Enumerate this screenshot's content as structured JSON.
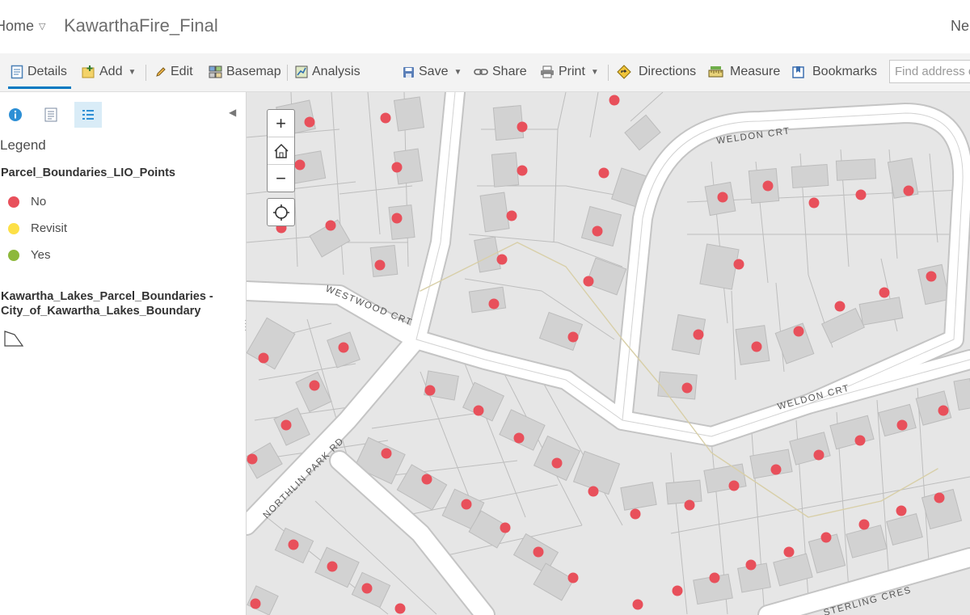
{
  "header": {
    "home_label": "Home",
    "map_title": "KawarthaFire_Final",
    "right_label": "Ne"
  },
  "toolbar": {
    "details": "Details",
    "add": "Add",
    "edit": "Edit",
    "basemap": "Basemap",
    "analysis": "Analysis",
    "save": "Save",
    "share": "Share",
    "print": "Print",
    "directions": "Directions",
    "measure": "Measure",
    "bookmarks": "Bookmarks",
    "search_placeholder": "Find address or place"
  },
  "panel": {
    "legend_title": "Legend",
    "layer1_title": "Parcel_Boundaries_LIO_Points",
    "legend_items": [
      {
        "label": "No",
        "color": "#e8505b"
      },
      {
        "label": "Revisit",
        "color": "#fde047"
      },
      {
        "label": "Yes",
        "color": "#8db83b"
      }
    ],
    "layer2_title_line1": "Kawartha_Lakes_Parcel_Boundaries -",
    "layer2_title_line2": "City_of_Kawartha_Lakes_Boundary"
  },
  "map": {
    "road_labels": [
      "WELDON CRT",
      "WESTWOOD CRT",
      "WELDON CRT",
      "NORTHLIN PARK RD",
      "STERLING CRES"
    ],
    "point_color": "#e8505b",
    "points": [
      [
        383,
        151
      ],
      [
        477,
        146
      ],
      [
        646,
        157
      ],
      [
        760,
        124
      ],
      [
        371,
        204
      ],
      [
        491,
        207
      ],
      [
        646,
        211
      ],
      [
        747,
        214
      ],
      [
        348,
        282
      ],
      [
        409,
        279
      ],
      [
        491,
        270
      ],
      [
        633,
        267
      ],
      [
        739,
        286
      ],
      [
        470,
        328
      ],
      [
        621,
        321
      ],
      [
        728,
        348
      ],
      [
        611,
        376
      ],
      [
        709,
        417
      ],
      [
        894,
        244
      ],
      [
        950,
        230
      ],
      [
        1007,
        251
      ],
      [
        1065,
        241
      ],
      [
        1124,
        236
      ],
      [
        914,
        327
      ],
      [
        1039,
        379
      ],
      [
        1094,
        362
      ],
      [
        1152,
        342
      ],
      [
        864,
        414
      ],
      [
        936,
        429
      ],
      [
        988,
        410
      ],
      [
        850,
        480
      ],
      [
        326,
        443
      ],
      [
        425,
        430
      ],
      [
        389,
        477
      ],
      [
        354,
        526
      ],
      [
        312,
        568
      ],
      [
        532,
        483
      ],
      [
        592,
        508
      ],
      [
        478,
        561
      ],
      [
        528,
        593
      ],
      [
        577,
        624
      ],
      [
        642,
        542
      ],
      [
        689,
        573
      ],
      [
        734,
        608
      ],
      [
        786,
        636
      ],
      [
        853,
        625
      ],
      [
        908,
        601
      ],
      [
        960,
        581
      ],
      [
        1013,
        563
      ],
      [
        1064,
        545
      ],
      [
        1116,
        526
      ],
      [
        1167,
        508
      ],
      [
        625,
        653
      ],
      [
        666,
        683
      ],
      [
        709,
        715
      ],
      [
        363,
        674
      ],
      [
        411,
        701
      ],
      [
        454,
        728
      ],
      [
        495,
        753
      ],
      [
        316,
        747
      ],
      [
        789,
        748
      ],
      [
        838,
        731
      ],
      [
        884,
        715
      ],
      [
        929,
        699
      ],
      [
        976,
        683
      ],
      [
        1022,
        665
      ],
      [
        1069,
        649
      ],
      [
        1115,
        632
      ],
      [
        1162,
        616
      ]
    ]
  }
}
